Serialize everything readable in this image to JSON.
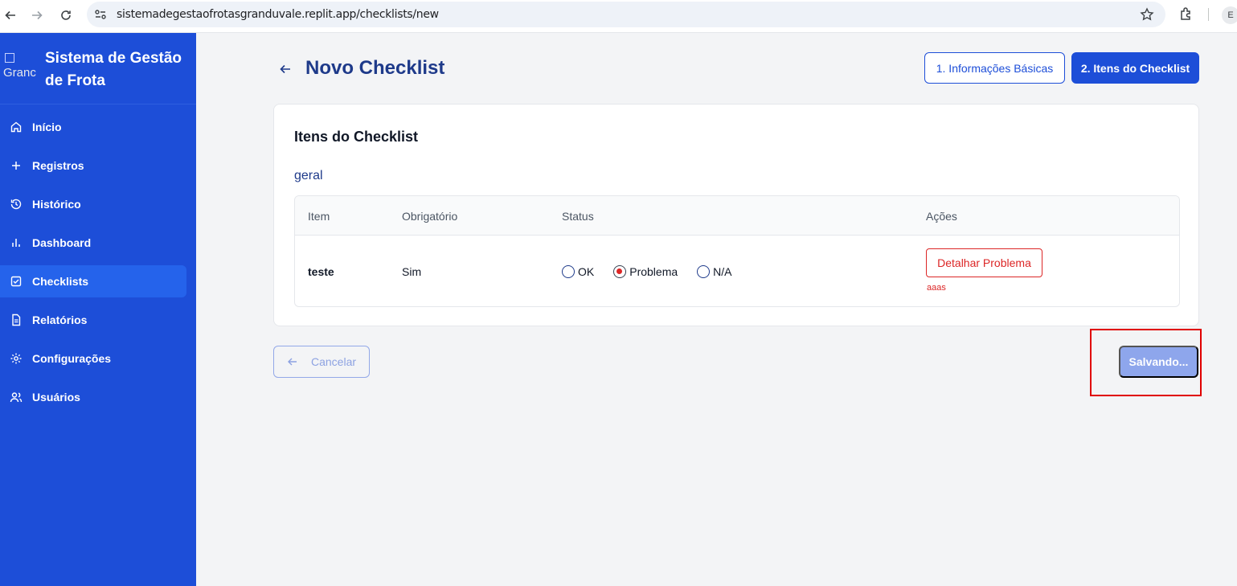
{
  "browser": {
    "url": "sistemadegestaofrotasgranduvale.replit.app/checklists/new",
    "profile_initial": "E"
  },
  "sidebar": {
    "logo_alt": "Granc",
    "brand_title": "Sistema de Gestão de Frota",
    "items": [
      {
        "label": "Início",
        "icon": "home-icon",
        "active": false
      },
      {
        "label": "Registros",
        "icon": "plus-icon",
        "active": false
      },
      {
        "label": "Histórico",
        "icon": "history-icon",
        "active": false
      },
      {
        "label": "Dashboard",
        "icon": "bar-chart-icon",
        "active": false
      },
      {
        "label": "Checklists",
        "icon": "checkbox-icon",
        "active": true
      },
      {
        "label": "Relatórios",
        "icon": "file-text-icon",
        "active": false
      },
      {
        "label": "Configurações",
        "icon": "gear-icon",
        "active": false
      },
      {
        "label": "Usuários",
        "icon": "users-icon",
        "active": false
      }
    ]
  },
  "header": {
    "title": "Novo Checklist",
    "steps": [
      {
        "label": "1. Informações Básicas",
        "active": false
      },
      {
        "label": "2. Itens do Checklist",
        "active": true
      }
    ]
  },
  "card": {
    "title": "Itens do Checklist",
    "category": "geral",
    "columns": [
      "Item",
      "Obrigatório",
      "Status",
      "Ações"
    ],
    "rows": [
      {
        "item": "teste",
        "required": "Sim",
        "status_options": [
          "OK",
          "Problema",
          "N/A"
        ],
        "selected_status": "Problema",
        "action_label": "Detalhar Problema",
        "problem_note": "aaas"
      }
    ]
  },
  "footer": {
    "cancel_label": "Cancelar",
    "save_label": "Salvando..."
  },
  "colors": {
    "sidebar_bg": "#1d4ed8",
    "primary": "#1d4ed8",
    "title": "#1e3a8a",
    "danger": "#dc2626",
    "annotation_box": "#e00000"
  }
}
